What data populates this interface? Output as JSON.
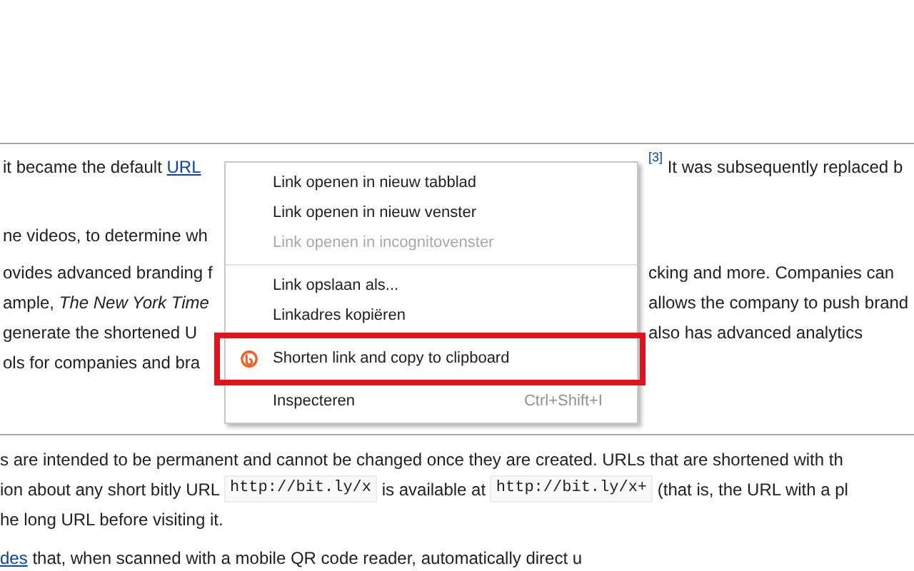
{
  "article_top": [
    {
      "lines": [
        {
          "left": [
            {
              "kind": "text",
              "text": "it became the default "
            },
            {
              "kind": "link",
              "text": "URL"
            }
          ],
          "right": [
            {
              "kind": "cite",
              "text": "[3]"
            },
            {
              "kind": "text",
              "text": " It was subsequently replaced b"
            }
          ]
        }
      ]
    },
    {
      "lines": [
        {
          "left": [
            {
              "kind": "text",
              "text": "ne videos, to determine wh"
            }
          ]
        }
      ]
    },
    {
      "lines": [
        {
          "left": [
            {
              "kind": "text",
              "text": "ovides advanced branding f"
            }
          ],
          "right": [
            {
              "kind": "text",
              "text": "cking and more. Companies can"
            }
          ]
        },
        {
          "left": [
            {
              "kind": "text",
              "text": "ample, "
            },
            {
              "kind": "italic",
              "text": "The New York Time"
            }
          ],
          "right": [
            {
              "kind": "text",
              "text": "allows the company to push brand"
            }
          ]
        },
        {
          "left": [
            {
              "kind": "text",
              "text": "generate the shortened U"
            }
          ],
          "right": [
            {
              "kind": "text",
              "text": "also has advanced analytics"
            }
          ]
        },
        {
          "left": [
            {
              "kind": "text",
              "text": "ols for companies and bra"
            }
          ]
        }
      ]
    }
  ],
  "article_bottom": [
    {
      "lines": [
        [
          {
            "kind": "text",
            "text": "s are intended to be permanent and cannot be changed once they are created. URLs that are shortened with th"
          }
        ],
        [
          {
            "kind": "text",
            "text": "ion about any short bitly URL "
          },
          {
            "kind": "code",
            "text": "http://bit.ly/x"
          },
          {
            "kind": "text",
            "text": " is available at "
          },
          {
            "kind": "code",
            "text": "http://bit.ly/x+"
          },
          {
            "kind": "text",
            "text": " (that is, the URL with a pl"
          }
        ],
        [
          {
            "kind": "text",
            "text": "he long URL before visiting it."
          }
        ]
      ]
    },
    {
      "lines": [
        [
          {
            "kind": "link",
            "text": "des"
          },
          {
            "kind": "text",
            "text": " that, when scanned with a mobile QR code reader, automatically direct u"
          }
        ]
      ]
    }
  ],
  "context_menu": {
    "groups": [
      [
        {
          "label": "Link openen in nieuw tabblad",
          "disabled": false
        },
        {
          "label": "Link openen in nieuw venster",
          "disabled": false
        },
        {
          "label": "Link openen in incognitovenster",
          "disabled": true
        }
      ],
      [
        {
          "label": "Link opslaan als...",
          "disabled": false
        },
        {
          "label": "Linkadres kopiëren",
          "disabled": false
        }
      ],
      [
        {
          "label": "Shorten link and copy to clipboard",
          "disabled": false,
          "icon": true,
          "highlighted": true
        }
      ],
      [
        {
          "label": "Inspecteren",
          "disabled": false,
          "shortcut": "Ctrl+Shift+I"
        }
      ]
    ]
  }
}
